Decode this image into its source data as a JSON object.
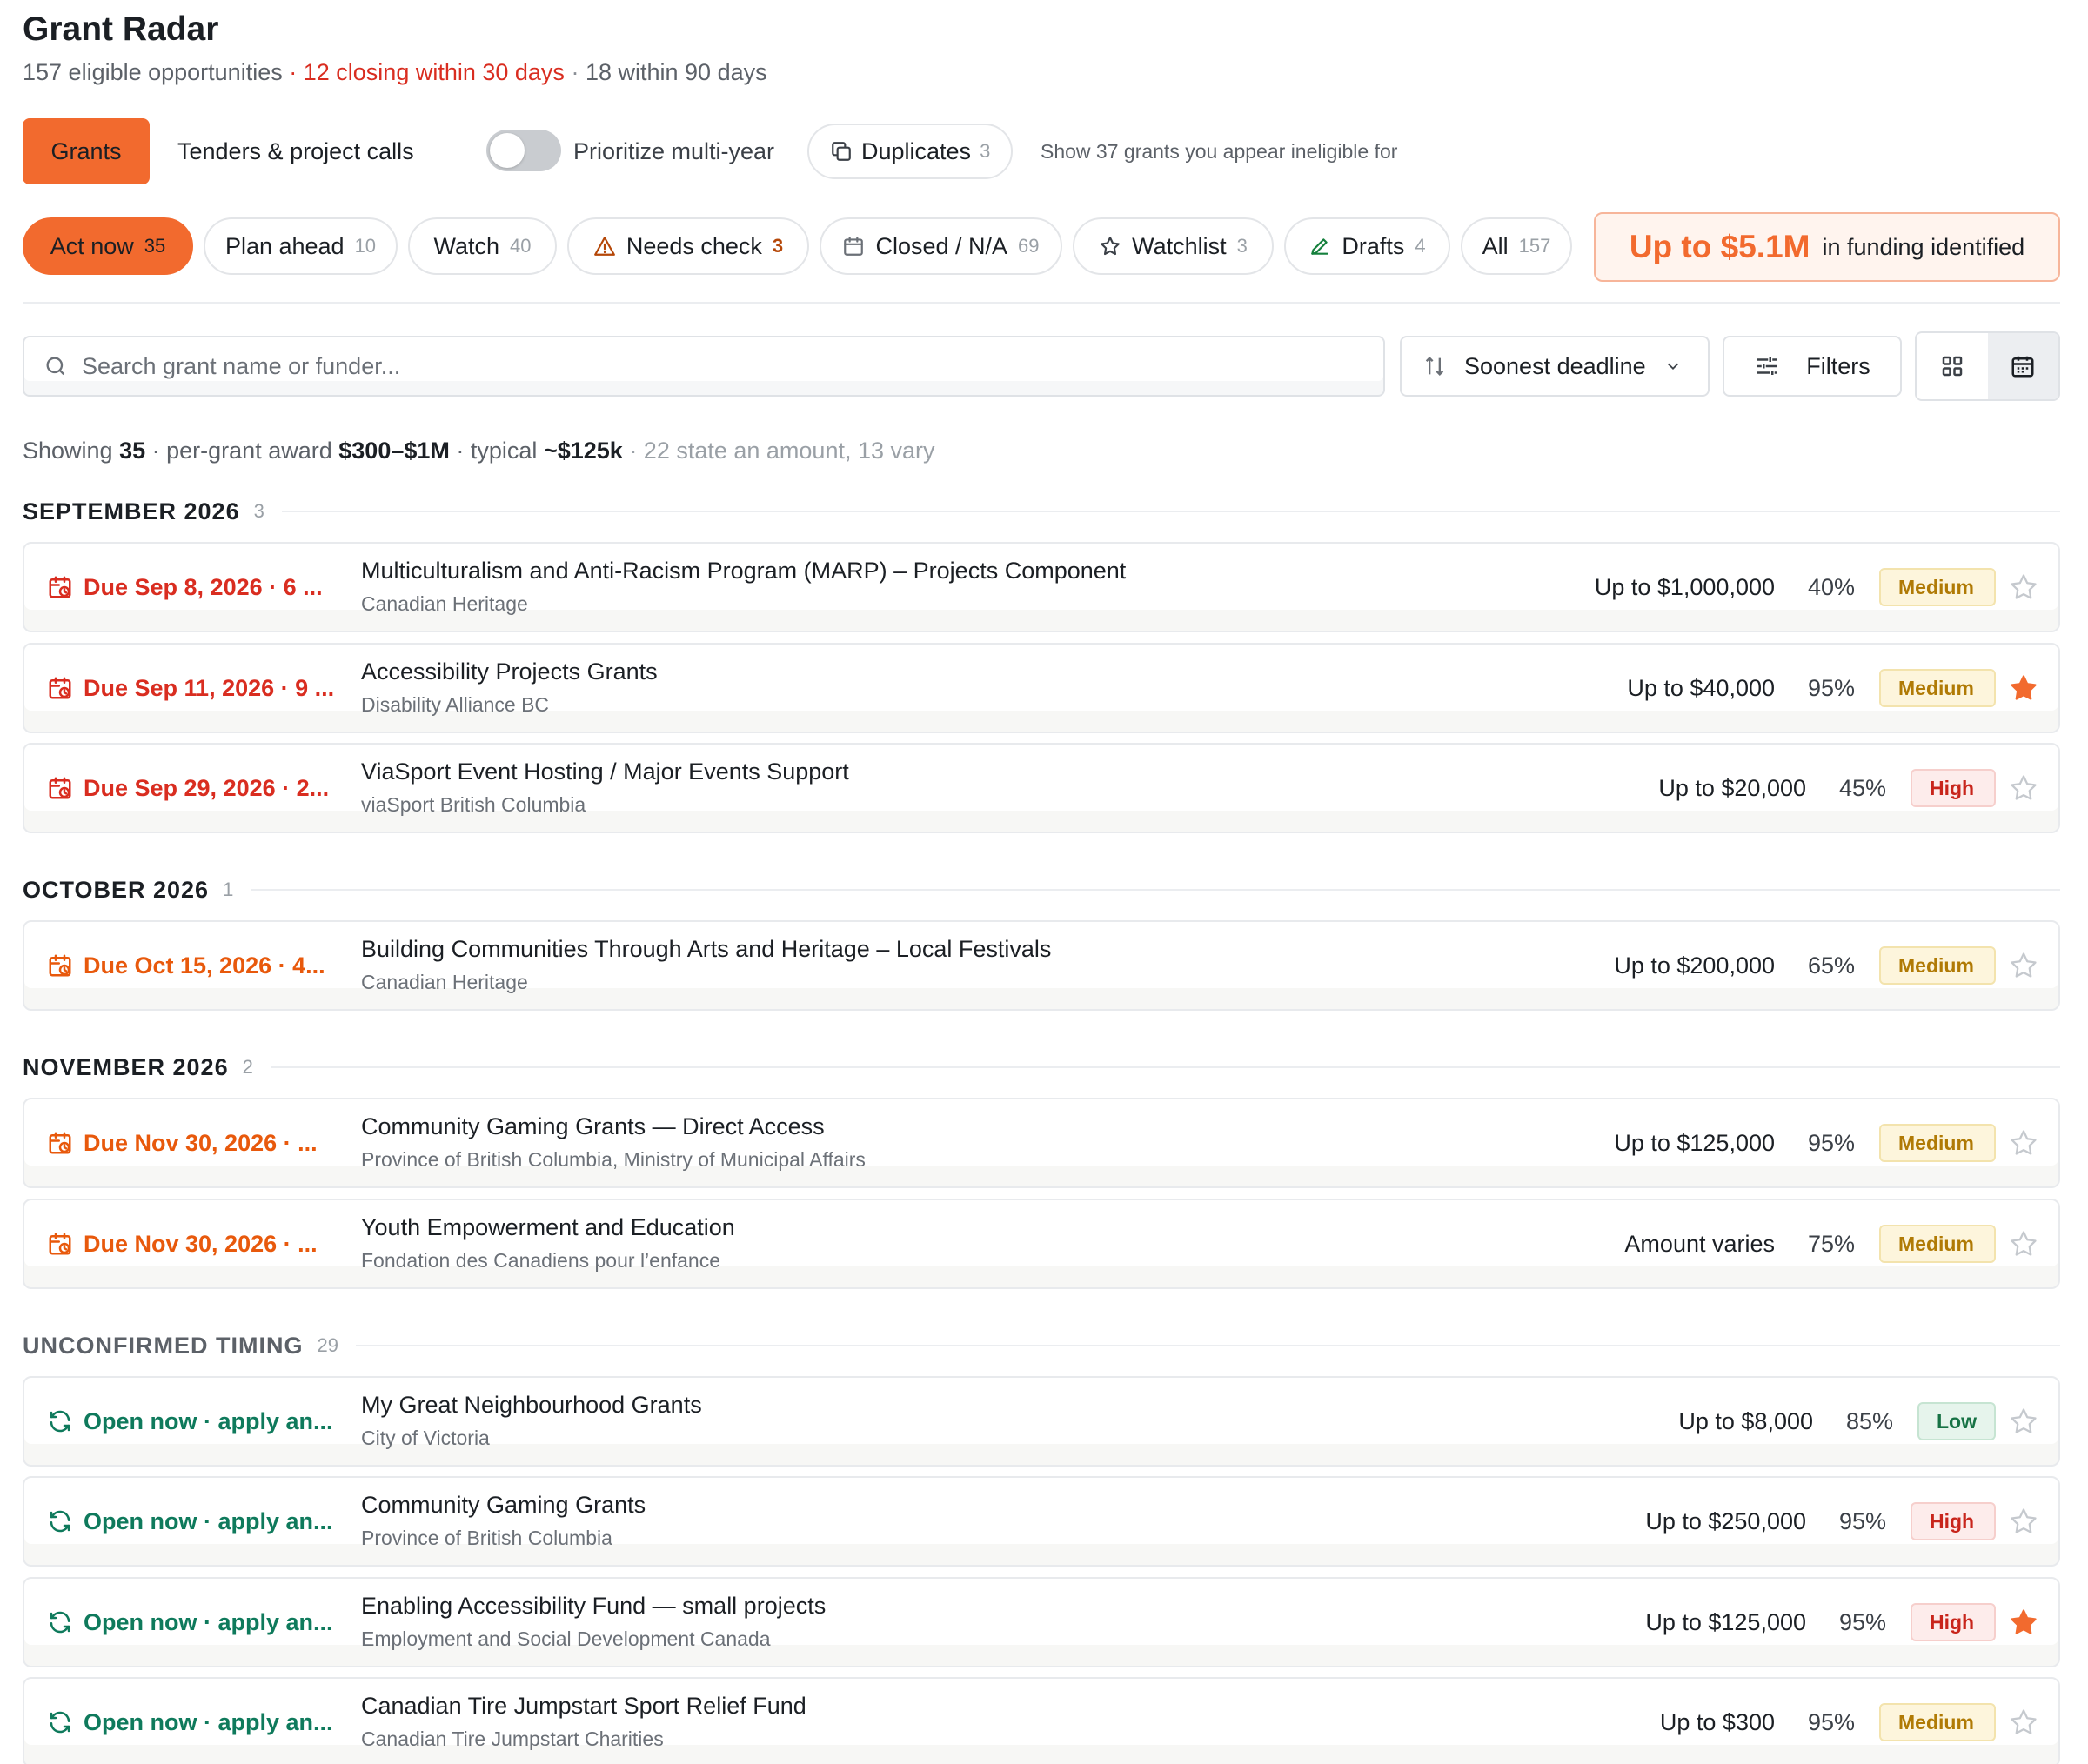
{
  "header": {
    "title": "Grant Radar",
    "eligible": "157 eligible opportunities",
    "sep1": "·",
    "closing30": "12 closing within 30 days",
    "sep2": "·",
    "within90": "18 within 90 days"
  },
  "toolbar": {
    "grants_label": "Grants",
    "tenders_label": "Tenders & project calls",
    "toggle_label": "Prioritize multi-year",
    "toggle_on": false,
    "duplicates_label": "Duplicates",
    "duplicates_count": "3",
    "ineligible_link": "Show 37 grants you appear ineligible for"
  },
  "tabs": [
    {
      "label": "Act now",
      "count": "35",
      "active": true
    },
    {
      "label": "Plan ahead",
      "count": "10"
    },
    {
      "label": "Watch",
      "count": "40"
    },
    {
      "label": "Needs check",
      "count": "3",
      "icon": "warning-icon"
    },
    {
      "label": "Closed / N/A",
      "count": "69",
      "icon": "calendar-x-icon"
    },
    {
      "label": "Watchlist",
      "count": "3",
      "icon": "star-icon"
    },
    {
      "label": "Drafts",
      "count": "4",
      "icon": "pencil-icon"
    },
    {
      "label": "All",
      "count": "157"
    }
  ],
  "funding": {
    "amount": "Up to $5.1M",
    "label": "in funding identified"
  },
  "search": {
    "placeholder": "Search grant name or funder..."
  },
  "sort": {
    "label": "Soonest deadline"
  },
  "filters": {
    "label": "Filters"
  },
  "summary": {
    "showing_label": "Showing",
    "showing_count": "35",
    "award_label": "· per-grant award",
    "award_range": "$300–$1M",
    "typical_label": "· typical",
    "typical_value": "~$125k",
    "note": "· 22 state an amount, 13 vary"
  },
  "sections": [
    {
      "name": "SEPTEMBER 2026",
      "count": "3"
    },
    {
      "name": "OCTOBER 2026",
      "count": "1"
    },
    {
      "name": "NOVEMBER 2026",
      "count": "2"
    },
    {
      "name": "UNCONFIRMED TIMING",
      "count": "29"
    }
  ],
  "grants": [
    {
      "due": "Due Sep 8, 2026 · 6 ...",
      "due_color": "red",
      "name": "Multiculturalism and Anti-Racism Program (MARP) – Projects Component",
      "funder": "Canadian Heritage",
      "amount": "Up to $1,000,000",
      "match": "40%",
      "priority": "Medium",
      "starred": false
    },
    {
      "due": "Due Sep 11, 2026 · 9 ...",
      "due_color": "red",
      "name": "Accessibility Projects Grants",
      "funder": "Disability Alliance BC",
      "amount": "Up to $40,000",
      "match": "95%",
      "priority": "Medium",
      "starred": true
    },
    {
      "due": "Due Sep 29, 2026 · 2...",
      "due_color": "red",
      "name": "ViaSport Event Hosting / Major Events Support",
      "funder": "viaSport British Columbia",
      "amount": "Up to $20,000",
      "match": "45%",
      "priority": "High",
      "starred": false
    },
    {
      "due": "Due Oct 15, 2026 · 4...",
      "due_color": "orange",
      "name": "Building Communities Through Arts and Heritage – Local Festivals",
      "funder": "Canadian Heritage",
      "amount": "Up to $200,000",
      "match": "65%",
      "priority": "Medium",
      "starred": false
    },
    {
      "due": "Due Nov 30, 2026 · ...",
      "due_color": "orange",
      "name": "Community Gaming Grants — Direct Access",
      "funder": "Province of British Columbia, Ministry of Municipal Affairs",
      "amount": "Up to $125,000",
      "match": "95%",
      "priority": "Medium",
      "starred": false
    },
    {
      "due": "Due Nov 30, 2026 · ...",
      "due_color": "orange",
      "name": "Youth Empowerment and Education",
      "funder": "Fondation des Canadiens pour l’enfance",
      "amount": "Amount varies",
      "match": "75%",
      "priority": "Medium",
      "starred": false
    },
    {
      "due": "Open now · apply an...",
      "due_color": "green",
      "name": "My Great Neighbourhood Grants",
      "funder": "City of Victoria",
      "amount": "Up to $8,000",
      "match": "85%",
      "priority": "Low",
      "starred": false
    },
    {
      "due": "Open now · apply an...",
      "due_color": "green",
      "name": "Community Gaming Grants",
      "funder": "Province of British Columbia",
      "amount": "Up to $250,000",
      "match": "95%",
      "priority": "High",
      "starred": false
    },
    {
      "due": "Open now · apply an...",
      "due_color": "green",
      "name": "Enabling Accessibility Fund — small projects",
      "funder": "Employment and Social Development Canada",
      "amount": "Up to $125,000",
      "match": "95%",
      "priority": "High",
      "starred": true
    },
    {
      "due": "Open now · apply an...",
      "due_color": "green",
      "name": "Canadian Tire Jumpstart Sport Relief Fund",
      "funder": "Canadian Tire Jumpstart Charities",
      "amount": "Up to $300",
      "match": "95%",
      "priority": "Medium",
      "starred": false
    }
  ],
  "colors": {
    "accent": "#f26a2e",
    "red": "#d92d20",
    "orange": "#e8590c",
    "green": "#0f7a5c"
  }
}
